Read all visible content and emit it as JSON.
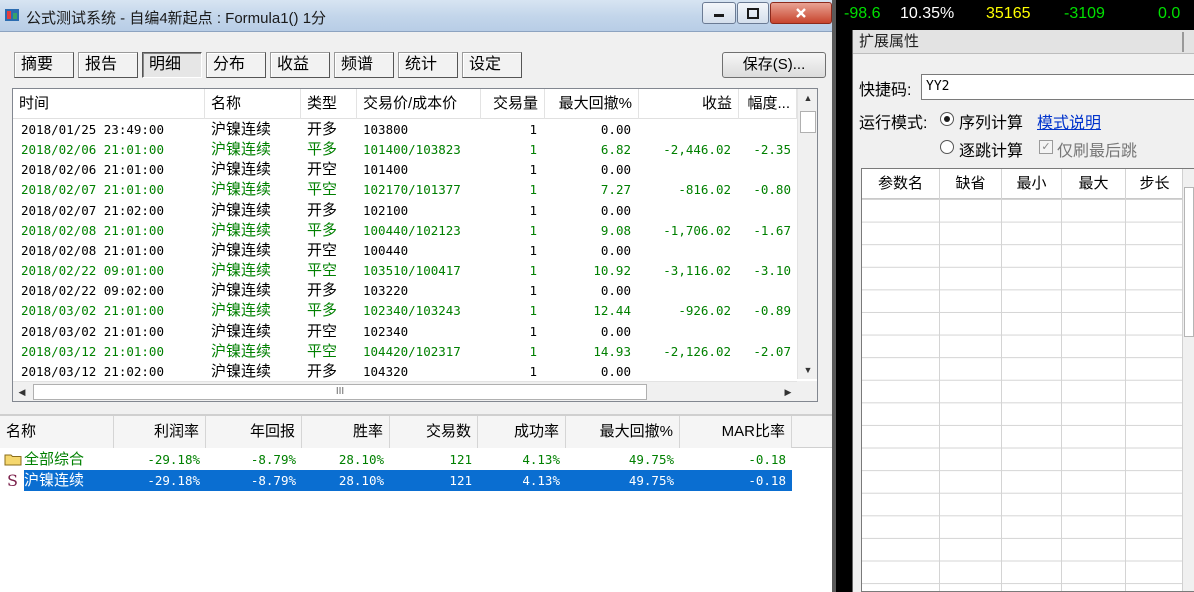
{
  "window": {
    "title": "公式测试系统 - 自编4新起点 : Formula1() 1分"
  },
  "tabs": [
    "摘要",
    "报告",
    "明细",
    "分布",
    "收益",
    "频谱",
    "统计",
    "设定"
  ],
  "active_tab": "明细",
  "save_label": "保存(S)...",
  "trade_table": {
    "columns": [
      "时间",
      "名称",
      "类型",
      "交易价/成本价",
      "交易量",
      "最大回撤%",
      "收益",
      "幅度..."
    ],
    "rows": [
      {
        "time": "2018/01/25 23:49:00",
        "name": "沪镍连续",
        "type": "开多",
        "price": "103800",
        "vol": "1",
        "dd": "0.00",
        "profit": "",
        "range": "",
        "color": "black"
      },
      {
        "time": "2018/02/06 21:01:00",
        "name": "沪镍连续",
        "type": "平多",
        "price": "101400/103823",
        "vol": "1",
        "dd": "6.82",
        "profit": "-2,446.02",
        "range": "-2.35",
        "color": "green"
      },
      {
        "time": "2018/02/06 21:01:00",
        "name": "沪镍连续",
        "type": "开空",
        "price": "101400",
        "vol": "1",
        "dd": "0.00",
        "profit": "",
        "range": "",
        "color": "black"
      },
      {
        "time": "2018/02/07 21:01:00",
        "name": "沪镍连续",
        "type": "平空",
        "price": "102170/101377",
        "vol": "1",
        "dd": "7.27",
        "profit": "-816.02",
        "range": "-0.80",
        "color": "green"
      },
      {
        "time": "2018/02/07 21:02:00",
        "name": "沪镍连续",
        "type": "开多",
        "price": "102100",
        "vol": "1",
        "dd": "0.00",
        "profit": "",
        "range": "",
        "color": "black"
      },
      {
        "time": "2018/02/08 21:01:00",
        "name": "沪镍连续",
        "type": "平多",
        "price": "100440/102123",
        "vol": "1",
        "dd": "9.08",
        "profit": "-1,706.02",
        "range": "-1.67",
        "color": "green"
      },
      {
        "time": "2018/02/08 21:01:00",
        "name": "沪镍连续",
        "type": "开空",
        "price": "100440",
        "vol": "1",
        "dd": "0.00",
        "profit": "",
        "range": "",
        "color": "black"
      },
      {
        "time": "2018/02/22 09:01:00",
        "name": "沪镍连续",
        "type": "平空",
        "price": "103510/100417",
        "vol": "1",
        "dd": "10.92",
        "profit": "-3,116.02",
        "range": "-3.10",
        "color": "green"
      },
      {
        "time": "2018/02/22 09:02:00",
        "name": "沪镍连续",
        "type": "开多",
        "price": "103220",
        "vol": "1",
        "dd": "0.00",
        "profit": "",
        "range": "",
        "color": "black"
      },
      {
        "time": "2018/03/02 21:01:00",
        "name": "沪镍连续",
        "type": "平多",
        "price": "102340/103243",
        "vol": "1",
        "dd": "12.44",
        "profit": "-926.02",
        "range": "-0.89",
        "color": "green"
      },
      {
        "time": "2018/03/02 21:01:00",
        "name": "沪镍连续",
        "type": "开空",
        "price": "102340",
        "vol": "1",
        "dd": "0.00",
        "profit": "",
        "range": "",
        "color": "black"
      },
      {
        "time": "2018/03/12 21:01:00",
        "name": "沪镍连续",
        "type": "平空",
        "price": "104420/102317",
        "vol": "1",
        "dd": "14.93",
        "profit": "-2,126.02",
        "range": "-2.07",
        "color": "green"
      },
      {
        "time": "2018/03/12 21:02:00",
        "name": "沪镍连续",
        "type": "开多",
        "price": "104320",
        "vol": "1",
        "dd": "0.00",
        "profit": "",
        "range": "",
        "color": "black"
      }
    ],
    "hscroll_grip": "III"
  },
  "summary_table": {
    "columns": [
      "名称",
      "利润率",
      "年回报",
      "胜率",
      "交易数",
      "成功率",
      "最大回撤%",
      "MAR比率"
    ],
    "rows": [
      {
        "icon": "folder-icon",
        "name": "全部综合",
        "profit_rate": "-29.18%",
        "annual": "-8.79%",
        "win": "28.10%",
        "trades": "121",
        "success": "4.13%",
        "dd": "49.75%",
        "mar": "-0.18",
        "selected": false
      },
      {
        "icon": "s-icon",
        "icon_text": "S",
        "name": "沪镍连续",
        "profit_rate": "-29.18%",
        "annual": "-8.79%",
        "win": "28.10%",
        "trades": "121",
        "success": "4.13%",
        "dd": "49.75%",
        "mar": "-0.18",
        "selected": true
      }
    ]
  },
  "ticker": {
    "values": [
      "-98.6",
      "10.35%",
      "35165",
      "-3109",
      "0.0"
    ],
    "colors": [
      "#00e000",
      "#ffffff",
      "#ffff00",
      "#00e000",
      "#00e000"
    ]
  },
  "props_panel": {
    "title": "扩展属性",
    "shortcut_label": "快捷码:",
    "shortcut_value": "YY2",
    "run_mode_label": "运行模式:",
    "mode_sequence": "序列计算",
    "mode_sequence_checked": true,
    "mode_link": "模式说明",
    "mode_tick": "逐跳计算",
    "mode_tick_checked": false,
    "refresh_last": "仅刷最后跳",
    "refresh_last_checked": true,
    "param_columns": [
      "参数名",
      "缺省",
      "最小",
      "最大",
      "步长"
    ]
  },
  "colors": {
    "title_bar": "#c2d5ea",
    "green_text": "#008000",
    "selection": "#0a6ed1",
    "link": "#0033cc"
  }
}
